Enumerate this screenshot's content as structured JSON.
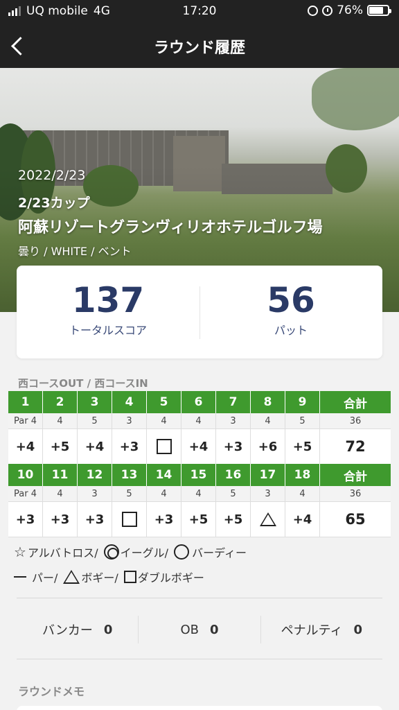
{
  "status_bar": {
    "carrier": "UQ mobile",
    "network": "4G",
    "time": "17:20",
    "battery": "76%",
    "battery_level": 0.76
  },
  "header": {
    "title": "ラウンド履歴"
  },
  "round": {
    "date": "2022/2/23",
    "competition": "2/23カップ",
    "course": "阿蘇リゾートグランヴィリオホテルゴルフ場",
    "conditions": "曇り / WHITE  / ベント"
  },
  "summary": {
    "total_score": "137",
    "total_score_label": "トータルスコア",
    "putts": "56",
    "putts_label": "パット"
  },
  "scorecard": {
    "course_title": "西コースOUT / 西コースIN",
    "total_label": "合計",
    "out": {
      "holes": [
        "1",
        "2",
        "3",
        "4",
        "5",
        "6",
        "7",
        "8",
        "9"
      ],
      "pars": [
        "Par 4",
        "4",
        "5",
        "3",
        "4",
        "4",
        "3",
        "4",
        "5"
      ],
      "par_total": "36",
      "results": [
        "+4",
        "+5",
        "+4",
        "+3",
        "square",
        "+4",
        "+3",
        "+6",
        "+5"
      ],
      "result_total": "72"
    },
    "in": {
      "holes": [
        "10",
        "11",
        "12",
        "13",
        "14",
        "15",
        "16",
        "17",
        "18"
      ],
      "pars": [
        "Par 4",
        "4",
        "3",
        "5",
        "4",
        "4",
        "5",
        "3",
        "4"
      ],
      "par_total": "36",
      "results": [
        "+3",
        "+3",
        "+3",
        "square",
        "+3",
        "+5",
        "+5",
        "triangle",
        "+4"
      ],
      "result_total": "65"
    }
  },
  "legend": {
    "albatross": "アルバトロス/",
    "eagle": "イーグル/",
    "birdie": "バーディー",
    "par": "パー/",
    "bogey": "ボギー/",
    "double_bogey": "ダブルボギー"
  },
  "stats": {
    "bunker_label": "バンカー",
    "bunker_value": "0",
    "ob_label": "OB",
    "ob_value": "0",
    "penalty_label": "ペナルティ",
    "penalty_value": "0"
  },
  "memo": {
    "title": "ラウンドメモ"
  },
  "colors": {
    "header_bg": "#222222",
    "hole_green": "#3f9a2e",
    "score_navy": "#2a3a66"
  }
}
